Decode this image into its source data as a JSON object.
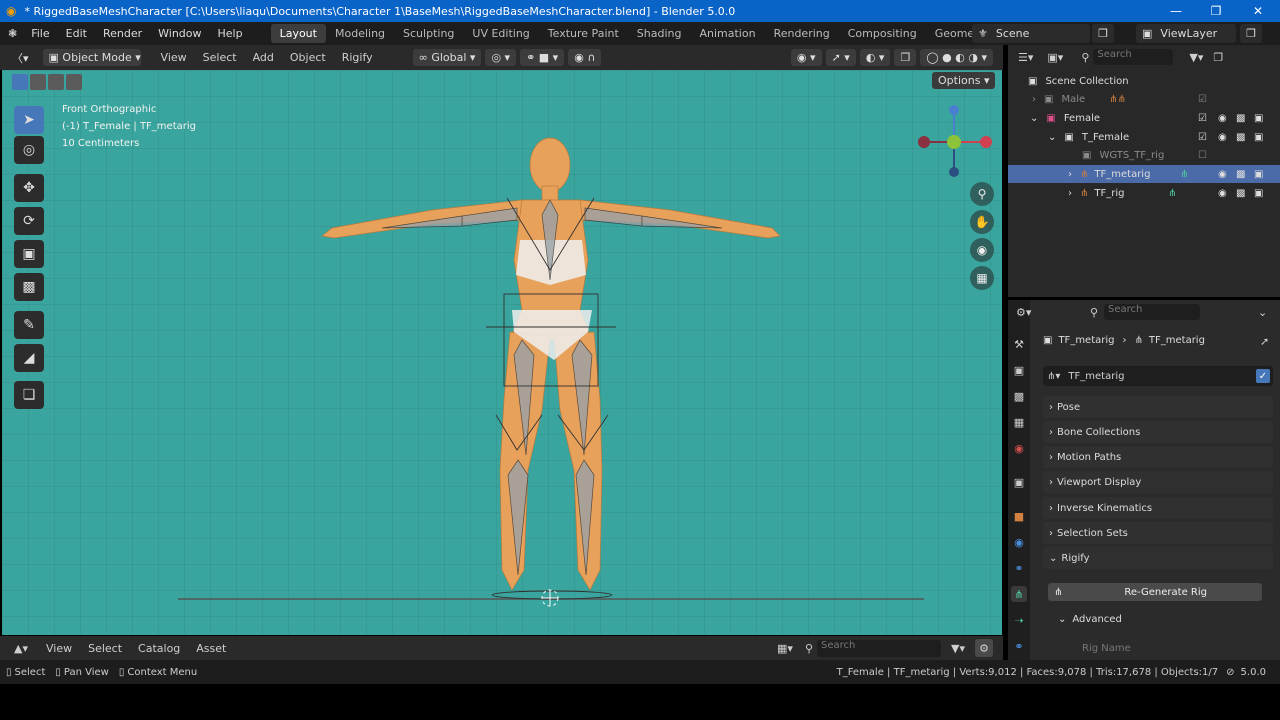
{
  "window": {
    "title": "* RiggedBaseMeshCharacter [C:\\Users\\liaqu\\Documents\\Character 1\\BaseMesh\\RiggedBaseMeshCharacter.blend] - Blender 5.0.0",
    "minimize": "—",
    "maximize": "❐",
    "close": "✕"
  },
  "menu": [
    "File",
    "Edit",
    "Render",
    "Window",
    "Help"
  ],
  "workspaces": [
    "Layout",
    "Modeling",
    "Sculpting",
    "UV Editing",
    "Texture Paint",
    "Shading",
    "Animation",
    "Rendering",
    "Compositing",
    "Geometry Node"
  ],
  "scene": {
    "name": "Scene",
    "view_layer": "ViewLayer"
  },
  "viewport_header": {
    "mode": "Object Mode",
    "menus": [
      "View",
      "Select",
      "Add",
      "Object",
      "Rigify"
    ],
    "orientation": "Global",
    "options": "Options"
  },
  "viewport": {
    "view_name": "Front Orthographic",
    "collection_info": "(-1) T_Female | TF_metarig",
    "scale": "10 Centimeters"
  },
  "outliner": {
    "search_placeholder": "Search",
    "rows": [
      {
        "label": "Scene Collection"
      },
      {
        "label": "Male"
      },
      {
        "label": "Female"
      },
      {
        "label": "T_Female"
      },
      {
        "label": "WGTS_TF_rig"
      },
      {
        "label": "TF_metarig"
      },
      {
        "label": "TF_rig"
      }
    ]
  },
  "properties": {
    "search_placeholder": "Search",
    "breadcrumb": [
      "TF_metarig",
      "TF_metarig"
    ],
    "armature_name": "TF_metarig",
    "panels": [
      "Pose",
      "Bone Collections",
      "Motion Paths",
      "Viewport Display",
      "Inverse Kinematics",
      "Selection Sets",
      "Rigify"
    ],
    "regenerate": "Re-Generate Rig",
    "advanced": "Advanced",
    "rig_name": "Rig Name"
  },
  "asset_bar": {
    "menus": [
      "View",
      "Select",
      "Catalog",
      "Asset"
    ],
    "search_placeholder": "Search"
  },
  "status": {
    "hints": [
      "Select",
      "Pan View",
      "Context Menu"
    ],
    "stats": "T_Female | TF_metarig | Verts:9,012 | Faces:9,078 | Tris:17,678 | Objects:1/7",
    "version": "5.0.0"
  },
  "colors": {
    "accent": "#4677b9",
    "viewport": "#3aa59e",
    "titlebar": "#0a64c8",
    "body": "#e8a15a"
  }
}
